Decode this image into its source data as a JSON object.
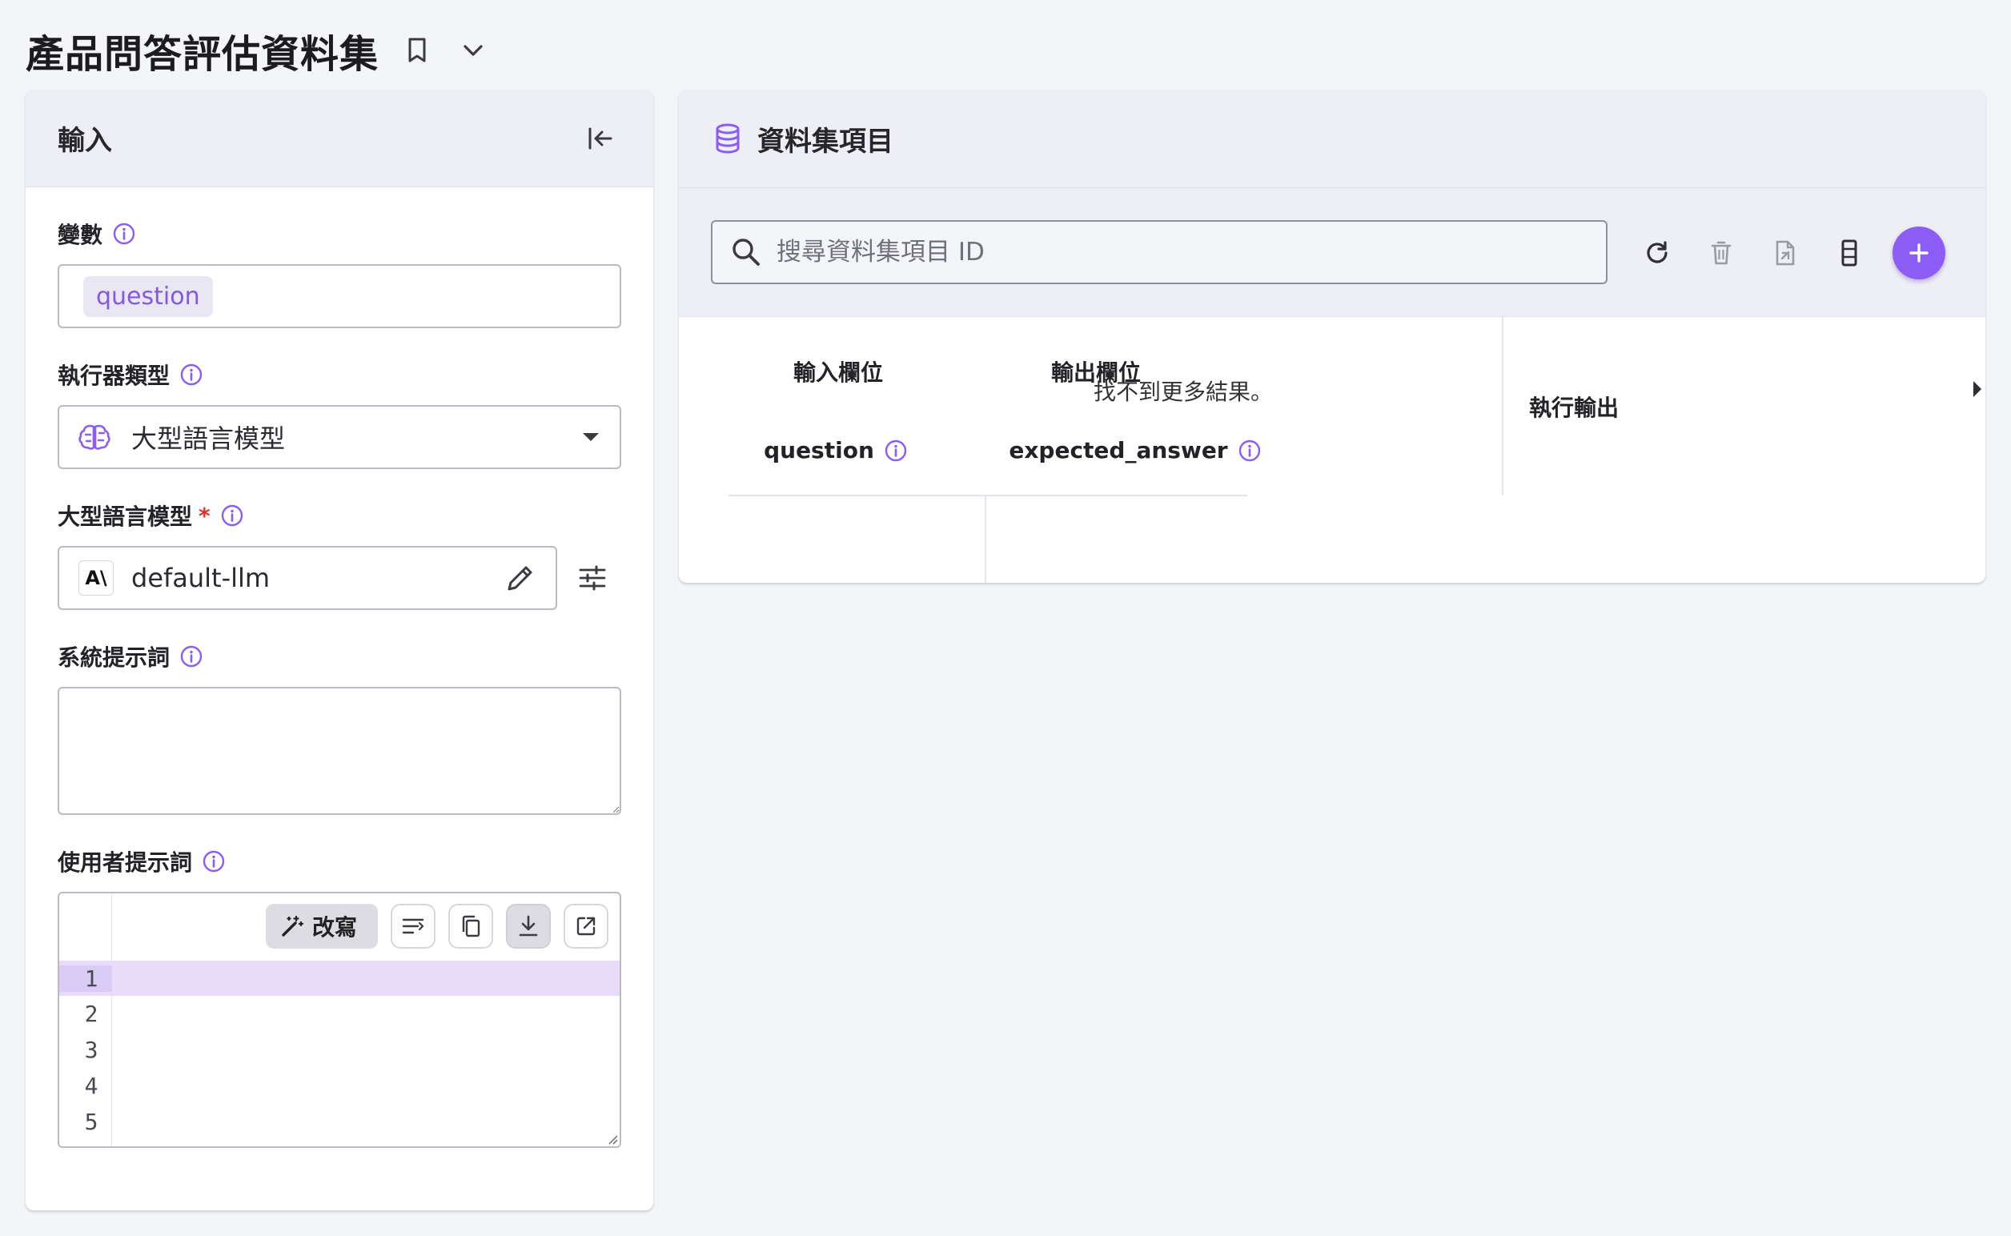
{
  "page": {
    "title": "產品問答評估資料集"
  },
  "input_panel": {
    "title": "輸入",
    "variables": {
      "label": "變數",
      "chips": [
        "question"
      ]
    },
    "executor_type": {
      "label": "執行器類型",
      "value": "大型語言模型"
    },
    "llm": {
      "label": "大型語言模型",
      "required_mark": "*",
      "logo_text": "A\\",
      "value": "default-llm"
    },
    "system_prompt": {
      "label": "系統提示詞",
      "value": ""
    },
    "user_prompt": {
      "label": "使用者提示詞",
      "rewrite_label": "改寫",
      "line_numbers": [
        "1",
        "2",
        "3",
        "4",
        "5"
      ],
      "current_line": 1
    }
  },
  "dataset_panel": {
    "title": "資料集項目",
    "search": {
      "placeholder": "搜尋資料集項目 ID"
    },
    "table": {
      "group_input": "輸入欄位",
      "group_output": "輸出欄位",
      "col_input": "question",
      "col_output": "expected_answer",
      "col_run_output": "執行輸出",
      "empty_message": "找不到更多結果。"
    }
  },
  "colors": {
    "accent": "#8b5cf6",
    "accent_text": "#8359e0",
    "required": "#e0312a",
    "panel_head_bg": "#eeeff4",
    "page_bg": "#f4f5f9",
    "current_line_bg": "#e7ddfb"
  }
}
